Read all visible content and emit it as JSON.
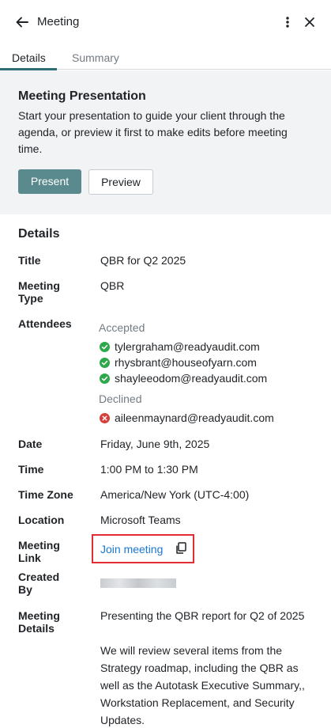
{
  "header": {
    "title": "Meeting",
    "back_icon": "arrow-left-icon",
    "more_icon": "kebab-vertical-icon",
    "close_icon": "close-icon"
  },
  "tabs": [
    {
      "label": "Details",
      "active": true
    },
    {
      "label": "Summary",
      "active": false
    }
  ],
  "presentation": {
    "title": "Meeting Presentation",
    "description": "Start your presentation to guide your client through the agenda, or preview it first to make edits before meeting time.",
    "present_label": "Present",
    "preview_label": "Preview"
  },
  "details": {
    "section_title": "Details",
    "title_label": "Title",
    "title_value": "QBR for Q2 2025",
    "type_label_1": "Meeting",
    "type_label_2": "Type",
    "type_value": "QBR",
    "attendees_label": "Attendees",
    "accepted_label": "Accepted",
    "accepted": [
      "tylergraham@readyaudit.com",
      "rhysbrant@houseofyarn.com",
      "shayleeodom@readyaudit.com"
    ],
    "declined_label": "Declined",
    "declined": [
      "aileenmaynard@readyaudit.com"
    ],
    "date_label": "Date",
    "date_value": "Friday, June 9th, 2025",
    "time_label": "Time",
    "time_value": "1:00 PM to 1:30 PM",
    "tz_label": "Time Zone",
    "tz_value": "America/New York (UTC-4:00)",
    "location_label": "Location",
    "location_value": "Microsoft Teams",
    "link_label_1": "Meeting",
    "link_label_2": "Link",
    "link_text": "Join meeting",
    "created_label_1": "Created",
    "created_label_2": "By",
    "meeting_details_label_1": "Meeting",
    "meeting_details_label_2": "Details",
    "meeting_details_p1": "Presenting the QBR report for Q2 of 2025",
    "meeting_details_p2": "We will review several items from the Strategy roadmap, including the QBR as well as the Autotask Executive Summary,, Workstation Replacement, and Security Updates."
  },
  "colors": {
    "accent": "#5a8a8e",
    "tab_underline": "#2f6e72",
    "link": "#1877d2",
    "accepted": "#2ea84a",
    "declined": "#d6403a",
    "highlight": "#e32d35"
  }
}
